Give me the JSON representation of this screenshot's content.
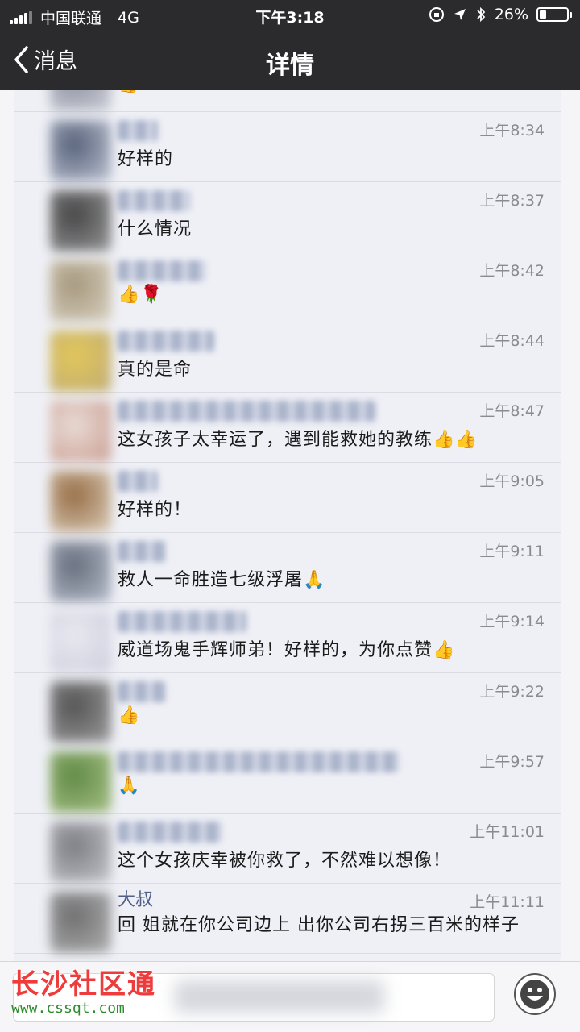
{
  "status": {
    "carrier": "中国联通",
    "network": "4G",
    "time": "下午3:18",
    "battery": "26%",
    "battery_level": 0.26
  },
  "nav": {
    "back_label": "消息",
    "title": "详情"
  },
  "comments": [
    {
      "time": "",
      "text": "👍"
    },
    {
      "time": "上午8:34",
      "text": "好样的"
    },
    {
      "time": "上午8:37",
      "text": "什么情况"
    },
    {
      "time": "上午8:42",
      "text": "👍🌹"
    },
    {
      "time": "上午8:44",
      "text": "真的是命"
    },
    {
      "time": "上午8:47",
      "text": "这女孩子太幸运了，遇到能救她的教练👍👍"
    },
    {
      "time": "上午9:05",
      "text": "好样的！"
    },
    {
      "time": "上午9:11",
      "text": "救人一命胜造七级浮屠🙏"
    },
    {
      "time": "上午9:14",
      "text": "威道场鬼手辉师弟！好样的，为你点赞👍"
    },
    {
      "time": "上午9:22",
      "text": "👍"
    },
    {
      "time": "上午9:57",
      "text": "🙏"
    },
    {
      "time": "上午11:01",
      "text": "这个女孩庆幸被你救了，不然难以想像！"
    },
    {
      "name": "大叔",
      "time": "上午11:11",
      "text": "回                    姐就在你公司边上  出你公司右拐三百米的样子"
    }
  ],
  "watermark": {
    "logo": "长沙社区通",
    "url": "www.cssqt.com"
  },
  "colors": {
    "bar": "#2b2b2d",
    "panel": "#eff0f6",
    "link": "#4f5f88"
  }
}
